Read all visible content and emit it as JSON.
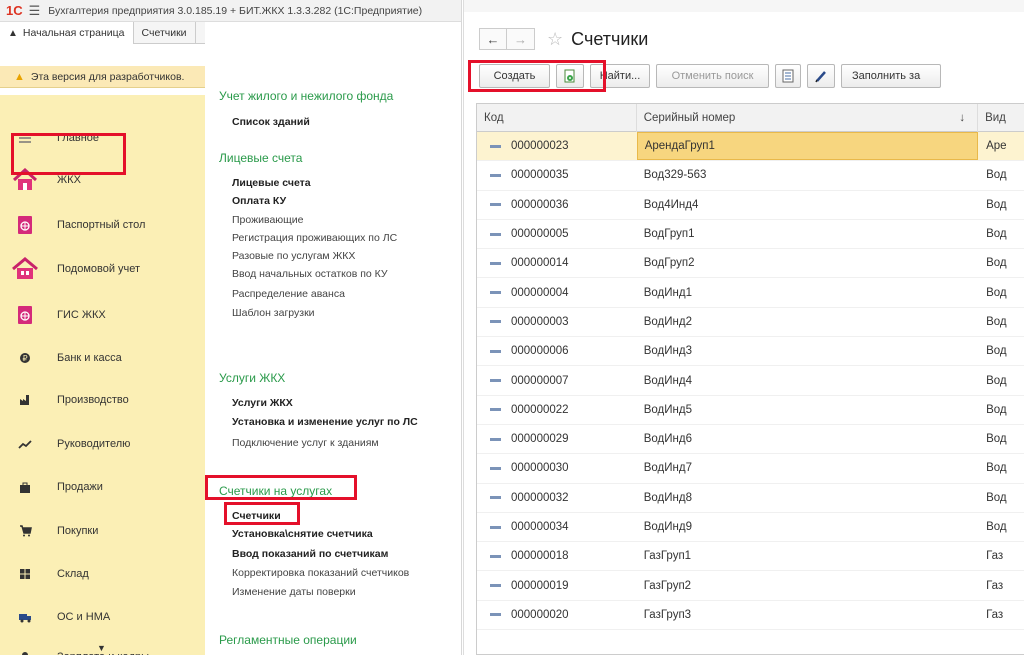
{
  "app": {
    "title": "Бухгалтерия предприятия 3.0.185.19 + БИТ.ЖКХ 1.3.3.282 (1С:Предприятие)",
    "logo": "1С",
    "tabs": [
      "Начальная страница",
      "Счетчики"
    ],
    "warning": "Эта версия для разработчиков."
  },
  "sidebar": {
    "items": [
      {
        "label": "Главное",
        "icon": "menu-icon"
      },
      {
        "label": "ЖКХ",
        "icon": "house-icon"
      },
      {
        "label": "Паспортный стол",
        "icon": "globe-book-icon"
      },
      {
        "label": "Подомовой учет",
        "icon": "houses-icon"
      },
      {
        "label": "ГИС ЖКХ",
        "icon": "globe-book-icon"
      },
      {
        "label": "Банк и касса",
        "icon": "coin-icon"
      },
      {
        "label": "Производство",
        "icon": "factory-icon"
      },
      {
        "label": "Руководителю",
        "icon": "trend-icon"
      },
      {
        "label": "Продажи",
        "icon": "bag-icon"
      },
      {
        "label": "Покупки",
        "icon": "cart-icon"
      },
      {
        "label": "Склад",
        "icon": "warehouse-icon"
      },
      {
        "label": "ОС и НМА",
        "icon": "truck-icon"
      },
      {
        "label": "Зарплата и кадры",
        "icon": "person-icon"
      }
    ]
  },
  "menu": {
    "sections": [
      {
        "title": "Учет жилого и нежилого фонда",
        "items": [
          {
            "label": "Список зданий",
            "bold": true
          }
        ]
      },
      {
        "title": "Лицевые счета",
        "items": [
          {
            "label": "Лицевые счета",
            "bold": true
          },
          {
            "label": "Оплата КУ",
            "bold": true
          },
          {
            "label": "Проживающие",
            "bold": false
          },
          {
            "label": "Регистрация проживающих по ЛС",
            "bold": false
          },
          {
            "label": "Разовые по услугам ЖКХ",
            "bold": false
          },
          {
            "label": "Ввод начальных остатков по КУ",
            "bold": false
          },
          {
            "label": "Распределение аванса",
            "bold": false
          },
          {
            "label": "Шаблон загрузки",
            "bold": false
          }
        ]
      },
      {
        "title": "Услуги ЖКХ",
        "items": [
          {
            "label": "Услуги ЖКХ",
            "bold": true
          },
          {
            "label": "Установка и изменение услуг по ЛС",
            "bold": true
          },
          {
            "label": "Подключение услуг к зданиям",
            "bold": false
          }
        ]
      },
      {
        "title": "Счетчики на услугах",
        "items": [
          {
            "label": "Счетчики",
            "bold": true
          },
          {
            "label": "Установка\\снятие счетчика",
            "bold": true
          },
          {
            "label": "Ввод показаний по счетчикам",
            "bold": true
          },
          {
            "label": "Корректировка показаний счетчиков",
            "bold": false
          },
          {
            "label": "Изменение даты поверки",
            "bold": false
          }
        ]
      },
      {
        "title": "Регламентные операции",
        "items": []
      }
    ]
  },
  "form": {
    "title": "Счетчики",
    "back": "←",
    "forward": "→",
    "toolbar": {
      "create": "Создать",
      "find": "Найти...",
      "cancel_search": "Отменить поиск",
      "fill": "Заполнить за"
    },
    "columns": [
      "Код",
      "Серийный номер",
      "Вид"
    ],
    "sort_arrow": "↓",
    "rows": [
      {
        "code": "000000023",
        "serial": "АрендаГруп1",
        "kind": "Аре"
      },
      {
        "code": "000000035",
        "serial": "Вод329-563",
        "kind": "Вод"
      },
      {
        "code": "000000036",
        "serial": "Вод4Инд4",
        "kind": "Вод"
      },
      {
        "code": "000000005",
        "serial": "ВодГруп1",
        "kind": "Вод"
      },
      {
        "code": "000000014",
        "serial": "ВодГруп2",
        "kind": "Вод"
      },
      {
        "code": "000000004",
        "serial": "ВодИнд1",
        "kind": "Вод"
      },
      {
        "code": "000000003",
        "serial": "ВодИнд2",
        "kind": "Вод"
      },
      {
        "code": "000000006",
        "serial": "ВодИнд3",
        "kind": "Вод"
      },
      {
        "code": "000000007",
        "serial": "ВодИнд4",
        "kind": "Вод"
      },
      {
        "code": "000000022",
        "serial": "ВодИнд5",
        "kind": "Вод"
      },
      {
        "code": "000000029",
        "serial": "ВодИнд6",
        "kind": "Вод"
      },
      {
        "code": "000000030",
        "serial": "ВодИнд7",
        "kind": "Вод"
      },
      {
        "code": "000000032",
        "serial": "ВодИнд8",
        "kind": "Вод"
      },
      {
        "code": "000000034",
        "serial": "ВодИнд9",
        "kind": "Вод"
      },
      {
        "code": "000000018",
        "serial": "ГазГруп1",
        "kind": "Газ"
      },
      {
        "code": "000000019",
        "serial": "ГазГруп2",
        "kind": "Газ"
      },
      {
        "code": "000000020",
        "serial": "ГазГруп3",
        "kind": "Газ"
      }
    ]
  },
  "colors": {
    "accent_green": "#2a9a4a",
    "sidebar_bg": "#fbefb5",
    "highlight_red": "#e4102a",
    "selected_row": "#fdf3d0"
  }
}
